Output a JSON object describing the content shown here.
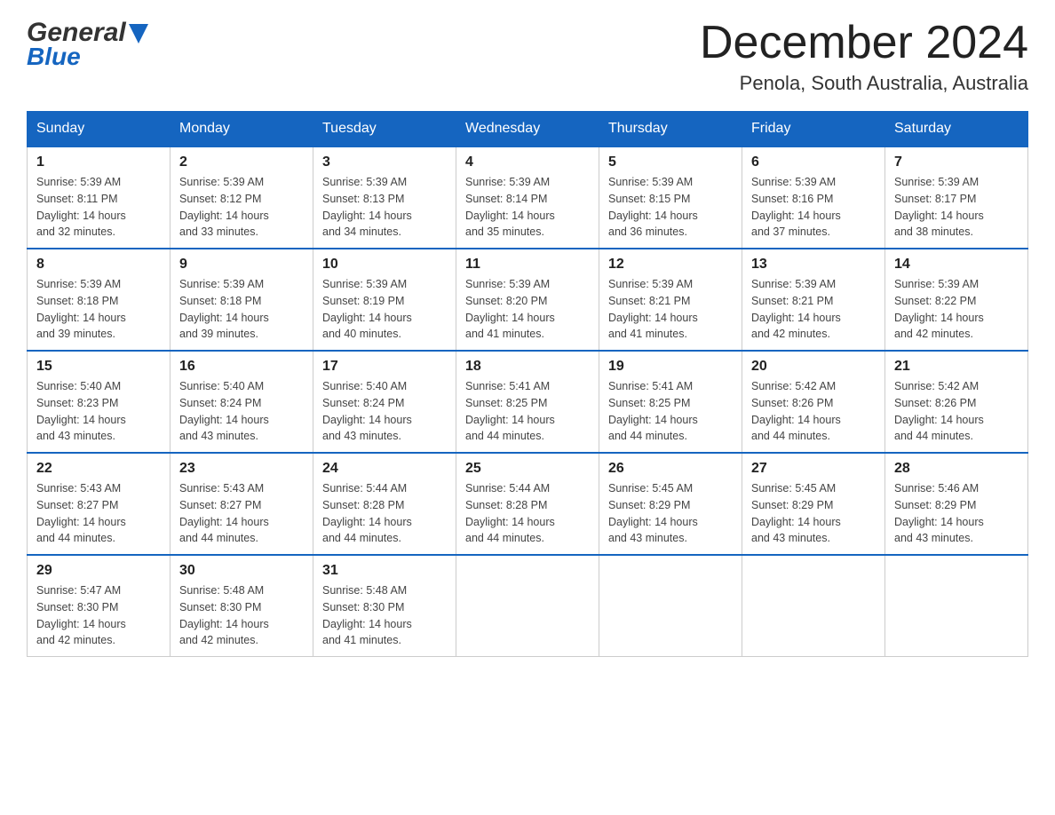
{
  "header": {
    "logo_general": "General",
    "logo_blue": "Blue",
    "month_title": "December 2024",
    "location": "Penola, South Australia, Australia"
  },
  "columns": [
    "Sunday",
    "Monday",
    "Tuesday",
    "Wednesday",
    "Thursday",
    "Friday",
    "Saturday"
  ],
  "weeks": [
    [
      {
        "day": "1",
        "sunrise": "5:39 AM",
        "sunset": "8:11 PM",
        "daylight": "14 hours and 32 minutes."
      },
      {
        "day": "2",
        "sunrise": "5:39 AM",
        "sunset": "8:12 PM",
        "daylight": "14 hours and 33 minutes."
      },
      {
        "day": "3",
        "sunrise": "5:39 AM",
        "sunset": "8:13 PM",
        "daylight": "14 hours and 34 minutes."
      },
      {
        "day": "4",
        "sunrise": "5:39 AM",
        "sunset": "8:14 PM",
        "daylight": "14 hours and 35 minutes."
      },
      {
        "day": "5",
        "sunrise": "5:39 AM",
        "sunset": "8:15 PM",
        "daylight": "14 hours and 36 minutes."
      },
      {
        "day": "6",
        "sunrise": "5:39 AM",
        "sunset": "8:16 PM",
        "daylight": "14 hours and 37 minutes."
      },
      {
        "day": "7",
        "sunrise": "5:39 AM",
        "sunset": "8:17 PM",
        "daylight": "14 hours and 38 minutes."
      }
    ],
    [
      {
        "day": "8",
        "sunrise": "5:39 AM",
        "sunset": "8:18 PM",
        "daylight": "14 hours and 39 minutes."
      },
      {
        "day": "9",
        "sunrise": "5:39 AM",
        "sunset": "8:18 PM",
        "daylight": "14 hours and 39 minutes."
      },
      {
        "day": "10",
        "sunrise": "5:39 AM",
        "sunset": "8:19 PM",
        "daylight": "14 hours and 40 minutes."
      },
      {
        "day": "11",
        "sunrise": "5:39 AM",
        "sunset": "8:20 PM",
        "daylight": "14 hours and 41 minutes."
      },
      {
        "day": "12",
        "sunrise": "5:39 AM",
        "sunset": "8:21 PM",
        "daylight": "14 hours and 41 minutes."
      },
      {
        "day": "13",
        "sunrise": "5:39 AM",
        "sunset": "8:21 PM",
        "daylight": "14 hours and 42 minutes."
      },
      {
        "day": "14",
        "sunrise": "5:39 AM",
        "sunset": "8:22 PM",
        "daylight": "14 hours and 42 minutes."
      }
    ],
    [
      {
        "day": "15",
        "sunrise": "5:40 AM",
        "sunset": "8:23 PM",
        "daylight": "14 hours and 43 minutes."
      },
      {
        "day": "16",
        "sunrise": "5:40 AM",
        "sunset": "8:24 PM",
        "daylight": "14 hours and 43 minutes."
      },
      {
        "day": "17",
        "sunrise": "5:40 AM",
        "sunset": "8:24 PM",
        "daylight": "14 hours and 43 minutes."
      },
      {
        "day": "18",
        "sunrise": "5:41 AM",
        "sunset": "8:25 PM",
        "daylight": "14 hours and 44 minutes."
      },
      {
        "day": "19",
        "sunrise": "5:41 AM",
        "sunset": "8:25 PM",
        "daylight": "14 hours and 44 minutes."
      },
      {
        "day": "20",
        "sunrise": "5:42 AM",
        "sunset": "8:26 PM",
        "daylight": "14 hours and 44 minutes."
      },
      {
        "day": "21",
        "sunrise": "5:42 AM",
        "sunset": "8:26 PM",
        "daylight": "14 hours and 44 minutes."
      }
    ],
    [
      {
        "day": "22",
        "sunrise": "5:43 AM",
        "sunset": "8:27 PM",
        "daylight": "14 hours and 44 minutes."
      },
      {
        "day": "23",
        "sunrise": "5:43 AM",
        "sunset": "8:27 PM",
        "daylight": "14 hours and 44 minutes."
      },
      {
        "day": "24",
        "sunrise": "5:44 AM",
        "sunset": "8:28 PM",
        "daylight": "14 hours and 44 minutes."
      },
      {
        "day": "25",
        "sunrise": "5:44 AM",
        "sunset": "8:28 PM",
        "daylight": "14 hours and 44 minutes."
      },
      {
        "day": "26",
        "sunrise": "5:45 AM",
        "sunset": "8:29 PM",
        "daylight": "14 hours and 43 minutes."
      },
      {
        "day": "27",
        "sunrise": "5:45 AM",
        "sunset": "8:29 PM",
        "daylight": "14 hours and 43 minutes."
      },
      {
        "day": "28",
        "sunrise": "5:46 AM",
        "sunset": "8:29 PM",
        "daylight": "14 hours and 43 minutes."
      }
    ],
    [
      {
        "day": "29",
        "sunrise": "5:47 AM",
        "sunset": "8:30 PM",
        "daylight": "14 hours and 42 minutes."
      },
      {
        "day": "30",
        "sunrise": "5:48 AM",
        "sunset": "8:30 PM",
        "daylight": "14 hours and 42 minutes."
      },
      {
        "day": "31",
        "sunrise": "5:48 AM",
        "sunset": "8:30 PM",
        "daylight": "14 hours and 41 minutes."
      },
      null,
      null,
      null,
      null
    ]
  ],
  "labels": {
    "sunrise": "Sunrise:",
    "sunset": "Sunset:",
    "daylight": "Daylight:"
  }
}
